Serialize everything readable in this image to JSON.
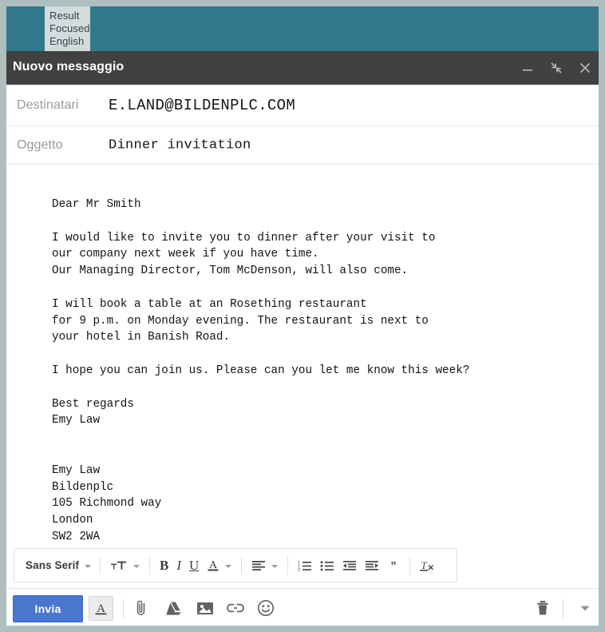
{
  "overlay_badge": {
    "name": "result-focused-english-badge",
    "lines": [
      "Result",
      "Focused",
      "English"
    ]
  },
  "window": {
    "title": "Nuovo messaggio",
    "controls": [
      {
        "name": "minimize-icon",
        "label": "minimize"
      },
      {
        "name": "exit-fullscreen-icon",
        "label": "exit full screen"
      },
      {
        "name": "close-icon",
        "label": "close"
      }
    ]
  },
  "fields": {
    "recipients": {
      "label": "Destinatari",
      "value": "E.LAND@BILDENPLC.COM",
      "placeholder": "Destinatari"
    },
    "subject": {
      "label": "Oggetto",
      "value": "Dinner invitation",
      "placeholder": "Oggetto"
    }
  },
  "message": {
    "body": "Dear Mr Smith\n\nI would like to invite you to dinner after your visit to\nour company next week if you have time.\nOur Managing Director, Tom McDenson, will also come.\n\nI will book a table at an Rosething restaurant\nfor 9 p.m. on Monday evening. The restaurant is next to\nyour hotel in Banish Road.\n\nI hope you can join us. Please can you let me know this week?\n\nBest regards\nEmy Law\n\n\nEmy Law\nBildenplc\n105 Richmond way\nLondon\nSW2 2WA"
  },
  "format_toolbar": {
    "font_family_label": "Sans Serif",
    "items": [
      {
        "name": "font-family-selector",
        "label": "Sans Serif"
      },
      {
        "name": "font-size-icon",
        "label": "Size"
      },
      {
        "name": "bold-icon",
        "label": "B"
      },
      {
        "name": "italic-icon",
        "label": "I"
      },
      {
        "name": "underline-icon",
        "label": "U"
      },
      {
        "name": "text-color-icon",
        "label": "A"
      },
      {
        "name": "align-icon",
        "label": "Align"
      },
      {
        "name": "numbered-list-icon",
        "label": "Numbered list"
      },
      {
        "name": "bulleted-list-icon",
        "label": "Bulleted list"
      },
      {
        "name": "outdent-icon",
        "label": "Decrease indent"
      },
      {
        "name": "indent-icon",
        "label": "Increase indent"
      },
      {
        "name": "quote-icon",
        "label": "Quote"
      },
      {
        "name": "remove-formatting-icon",
        "label": "Remove formatting"
      }
    ]
  },
  "action_bar": {
    "send_label": "Invia",
    "icons": [
      {
        "name": "formatting-options-icon",
        "label": "A"
      },
      {
        "name": "attach-file-icon",
        "label": "Attach files"
      },
      {
        "name": "insert-drive-icon",
        "label": "Insert files using Drive"
      },
      {
        "name": "insert-photo-icon",
        "label": "Insert photo"
      },
      {
        "name": "insert-link-icon",
        "label": "Insert link"
      },
      {
        "name": "insert-emoji-icon",
        "label": "Insert emoji"
      },
      {
        "name": "discard-draft-icon",
        "label": "Discard draft"
      },
      {
        "name": "more-options-icon",
        "label": "More options"
      }
    ]
  },
  "colors": {
    "frame": "#aebfc0",
    "teal_band": "#33788c",
    "titlebar": "#414141",
    "send_button": "#4a76cd",
    "badge_bg": "#d3dbdc",
    "body_text": "#131313",
    "label_gray": "#9a9a9a"
  }
}
